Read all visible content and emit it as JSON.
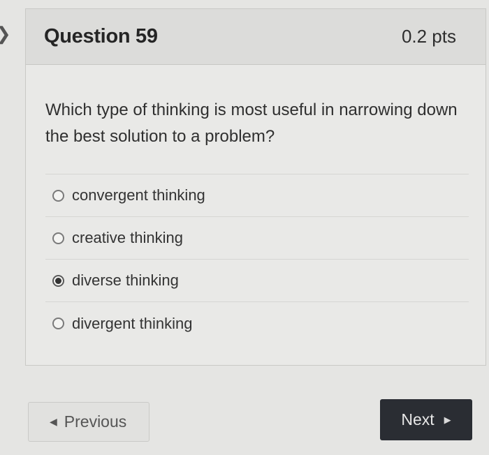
{
  "question": {
    "title": "Question 59",
    "points": "0.2 pts",
    "text": "Which type of thinking is most useful in narrowing down the best solution to a problem?",
    "answers": [
      {
        "label": "convergent thinking",
        "selected": false
      },
      {
        "label": "creative thinking",
        "selected": false
      },
      {
        "label": "diverse thinking",
        "selected": true
      },
      {
        "label": "divergent thinking",
        "selected": false
      }
    ]
  },
  "nav": {
    "previous_label": "Previous",
    "next_label": "Next"
  },
  "icons": {
    "previous": "triangle-left-icon",
    "next": "triangle-right-icon",
    "left_edge": "chevron-left-icon"
  }
}
